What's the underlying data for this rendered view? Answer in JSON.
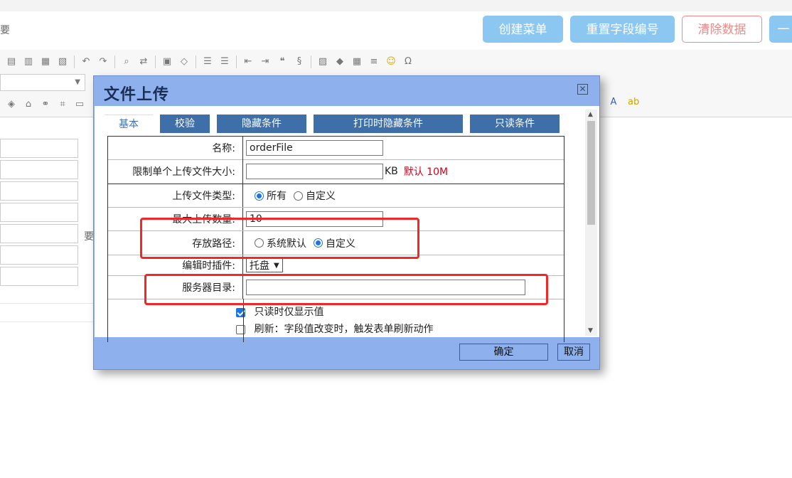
{
  "header": {
    "crumb": "要",
    "buttons": {
      "create_menu": "创建菜单",
      "reset_field_numbers": "重置字段编号",
      "clear_data": "清除数据",
      "extra": "一"
    }
  },
  "editor": {
    "bg_text": "要"
  },
  "dialog": {
    "title": "文件上传",
    "tabs": [
      "基本",
      "校验",
      "隐藏条件",
      "打印时隐藏条件",
      "只读条件"
    ],
    "fields": {
      "name_label": "名称:",
      "name_value": "orderFile",
      "size_label": "限制单个上传文件大小:",
      "size_value": "",
      "size_unit": "KB",
      "size_default": "默认 10M",
      "type_label": "上传文件类型:",
      "type_all": "所有",
      "type_custom": "自定义",
      "max_label": "最大上传数量:",
      "max_value": "10",
      "path_label": "存放路径:",
      "path_default": "系统默认",
      "path_custom": "自定义",
      "plugin_label": "编辑时插件:",
      "plugin_value": "托盘",
      "server_label": "服务器目录:",
      "server_value": "",
      "readonly_label": "只读时仅显示值",
      "refresh_label": "刷新：字段值改变时，触发表单刷新动作"
    },
    "footer": {
      "ok": "确定",
      "cancel": "取消"
    }
  },
  "colors": {
    "dialog_bg": "#8eb1ee",
    "tab_bg": "#3f6fa8",
    "highlight": "#f02828",
    "default_hint": "#d0021b",
    "accent": "#8cc7f2"
  }
}
